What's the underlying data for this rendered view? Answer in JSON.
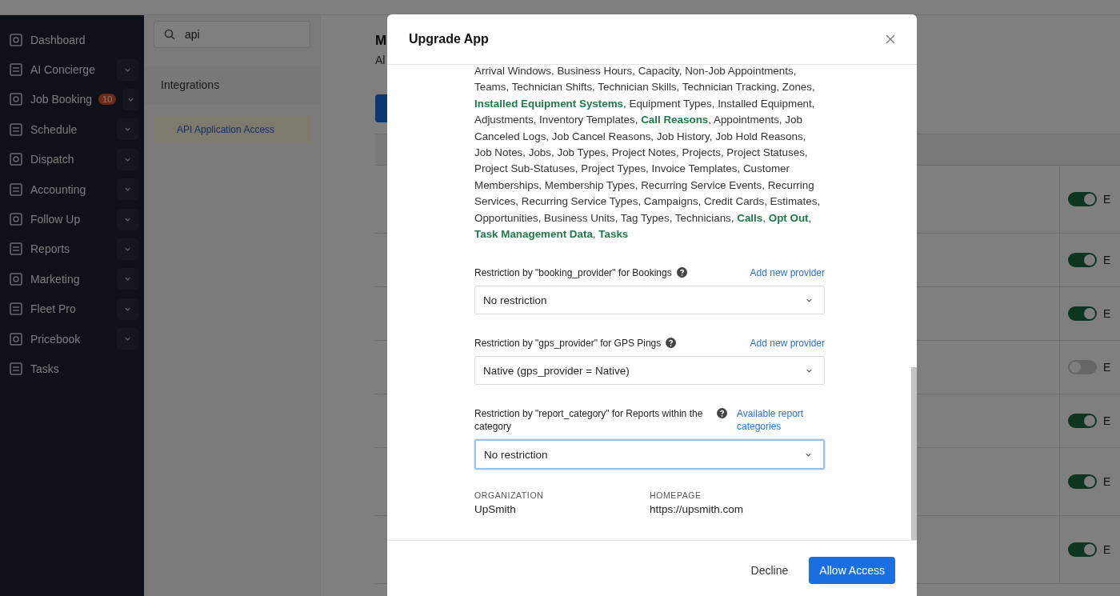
{
  "sidebar": {
    "items": [
      {
        "label": "Dashboard",
        "expandable": false
      },
      {
        "label": "AI Concierge",
        "expandable": true
      },
      {
        "label": "Job Booking",
        "expandable": true,
        "badge": "10"
      },
      {
        "label": "Schedule",
        "expandable": true
      },
      {
        "label": "Dispatch",
        "expandable": true
      },
      {
        "label": "Accounting",
        "expandable": true
      },
      {
        "label": "Follow Up",
        "expandable": true
      },
      {
        "label": "Reports",
        "expandable": true
      },
      {
        "label": "Marketing",
        "expandable": true
      },
      {
        "label": "Fleet Pro",
        "expandable": true
      },
      {
        "label": "Pricebook",
        "expandable": true
      },
      {
        "label": "Tasks",
        "expandable": false
      }
    ]
  },
  "settings_nav": {
    "search": {
      "value": "api"
    },
    "section": "Integrations",
    "items": [
      {
        "label": "API Application Access",
        "selected": true
      }
    ]
  },
  "main": {
    "title": "M",
    "subtitle": "Al",
    "rows": [
      {
        "on": true,
        "label": "E"
      },
      {
        "on": true,
        "label": "E"
      },
      {
        "on": true,
        "label": "E"
      },
      {
        "on": false,
        "label": "E"
      },
      {
        "on": true,
        "label": "E"
      },
      {
        "on": true,
        "label": "E"
      },
      {
        "on": true,
        "label": "E"
      }
    ]
  },
  "dialog": {
    "title": "Upgrade App",
    "scopes": "Arrival Windows, Business Hours, Capacity, Non-Job Appointments, Teams, Technician Shifts, Technician Skills, Technician Tracking, Zones, **Installed Equipment Systems**, Equipment Types, Installed Equipment, Adjustments, Inventory Templates, **Call Reasons**, Appointments, Job Canceled Logs, Job Cancel Reasons, Job History, Job Hold Reasons, Job Notes, Jobs, Job Types, Project Notes, Projects, Project Statuses, Project Sub-Statuses, Project Types, Invoice Templates, Customer Memberships, Membership Types, Recurring Service Events, Recurring Services, Recurring Service Types, Campaigns, Credit Cards, Estimates, Opportunities, Business Units, Tag Types, Technicians, **Calls**, **Opt Out**, **Task Management Data**, **Tasks**",
    "restrictions": [
      {
        "label": "Restriction by \"booking_provider\" for Bookings",
        "link": "Add new provider",
        "value": "No restriction",
        "focused": false
      },
      {
        "label": "Restriction by \"gps_provider\" for GPS Pings",
        "link": "Add new provider",
        "value": "Native (gps_provider = Native)",
        "focused": false
      },
      {
        "label": "Restriction by \"report_category\" for Reports within the category",
        "link": "Available report categories",
        "value": "No restriction",
        "focused": true
      }
    ],
    "details": [
      {
        "label": "ORGANIZATION",
        "value": "UpSmith"
      },
      {
        "label": "HOMEPAGE",
        "value": "https://upsmith.com"
      }
    ],
    "buttons": [
      {
        "label": "Decline",
        "kind": "secondary"
      },
      {
        "label": "Allow Access",
        "kind": "primary"
      }
    ]
  }
}
